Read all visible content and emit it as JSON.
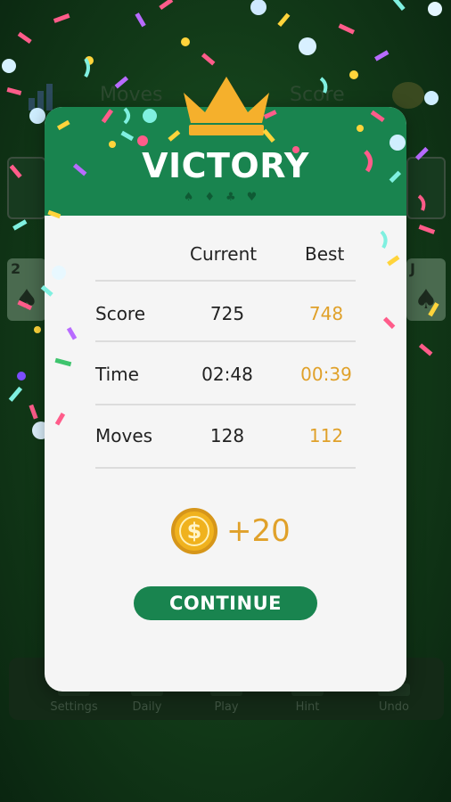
{
  "header": {
    "moves_label": "Moves",
    "score_label": "Score",
    "stats_icon": "bar-chart-icon",
    "theme_icon": "palette-icon"
  },
  "toolbar": {
    "items": [
      {
        "label": "Settings",
        "icon": "gear-icon"
      },
      {
        "label": "Daily",
        "icon": "calendar-icon"
      },
      {
        "label": "Play",
        "icon": "cards-icon"
      },
      {
        "label": "Hint",
        "icon": "lightbulb-icon"
      },
      {
        "label": "Undo",
        "icon": "undo-icon"
      }
    ]
  },
  "dialog": {
    "title": "VICTORY",
    "suits": "♠♦♣♥",
    "columns": {
      "current": "Current",
      "best": "Best"
    },
    "rows": [
      {
        "label": "Score",
        "current": "725",
        "best": "748"
      },
      {
        "label": "Time",
        "current": "02:48",
        "best": "00:39"
      },
      {
        "label": "Moves",
        "current": "128",
        "best": "112"
      }
    ],
    "reward": {
      "symbol": "$",
      "amount": "+20"
    },
    "continue_label": "CONTINUE"
  },
  "colors": {
    "accent_green": "#19844f",
    "best_gold": "#e0a12a",
    "crown_gold": "#f5b02c",
    "dialog_bg": "#f5f5f5"
  }
}
